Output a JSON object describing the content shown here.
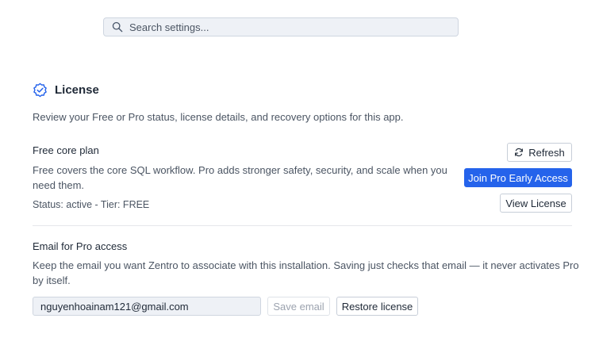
{
  "search": {
    "placeholder": "Search settings..."
  },
  "license": {
    "title": "License",
    "description": "Review your Free or Pro status, license details, and recovery options for this app.",
    "plan_title": "Free core plan",
    "plan_description": "Free covers the core SQL workflow. Pro adds stronger safety, security, and scale when you need them.",
    "status": "Status: active - Tier: FREE",
    "refresh_label": "Refresh",
    "join_label": "Join Pro Early Access",
    "view_label": "View License"
  },
  "email": {
    "title": "Email for Pro access",
    "description": "Keep the email you want Zentro to associate with this installation. Saving just checks that email — it never activates Pro by itself.",
    "value": "nguyenhoainam121@gmail.com",
    "save_label": "Save email",
    "save_disabled": true,
    "restore_label": "Restore license"
  },
  "colors": {
    "accent": "#2563eb",
    "section_icon": "#2563eb"
  },
  "icons": {
    "search": "search-icon",
    "section": "badge-check-icon",
    "refresh": "refresh-icon"
  }
}
